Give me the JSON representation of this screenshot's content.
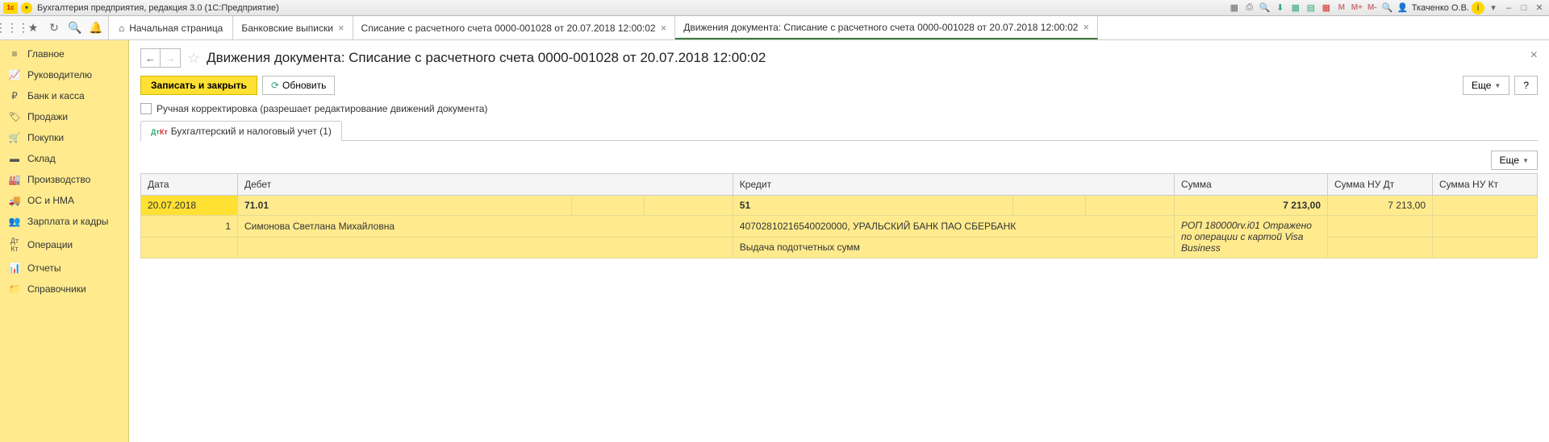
{
  "titlebar": {
    "app_title": "Бухгалтерия предприятия, редакция 3.0  (1С:Предприятие)",
    "user": "Ткаченко О.В."
  },
  "tabs": {
    "home": "Начальная страница",
    "t1": "Банковские выписки",
    "t2": "Списание с расчетного счета 0000-001028 от 20.07.2018 12:00:02",
    "t3": "Движения документа: Списание с расчетного счета 0000-001028 от 20.07.2018 12:00:02"
  },
  "sidebar": {
    "items": [
      "Главное",
      "Руководителю",
      "Банк и касса",
      "Продажи",
      "Покупки",
      "Склад",
      "Производство",
      "ОС и НМА",
      "Зарплата и кадры",
      "Операции",
      "Отчеты",
      "Справочники"
    ]
  },
  "page": {
    "title": "Движения документа: Списание с расчетного счета 0000-001028 от 20.07.2018 12:00:02",
    "save_close": "Записать и закрыть",
    "refresh": "Обновить",
    "more": "Еще",
    "help": "?",
    "manual_edit": "Ручная корректировка (разрешает редактирование движений документа)",
    "tab_label": "Бухгалтерский и налоговый учет (1)"
  },
  "table": {
    "headers": {
      "date": "Дата",
      "debit": "Дебет",
      "credit": "Кредит",
      "sum": "Сумма",
      "nudt": "Сумма НУ Дт",
      "nukt": "Сумма НУ Кт"
    },
    "row1": {
      "date": "20.07.2018",
      "debit": "71.01",
      "credit": "51",
      "sum": "7 213,00",
      "nudt": "7 213,00",
      "num": "1"
    },
    "row2": {
      "debit_sub": "Симонова Светлана Михайловна",
      "credit_sub": "40702810216540020000, УРАЛЬСКИЙ БАНК ПАО СБЕРБАНК",
      "note": "РОП 180000rv.i01 Отражено по операции с картой Visa Business"
    },
    "row3": {
      "credit_sub2": "Выдача подотчетных сумм"
    }
  }
}
